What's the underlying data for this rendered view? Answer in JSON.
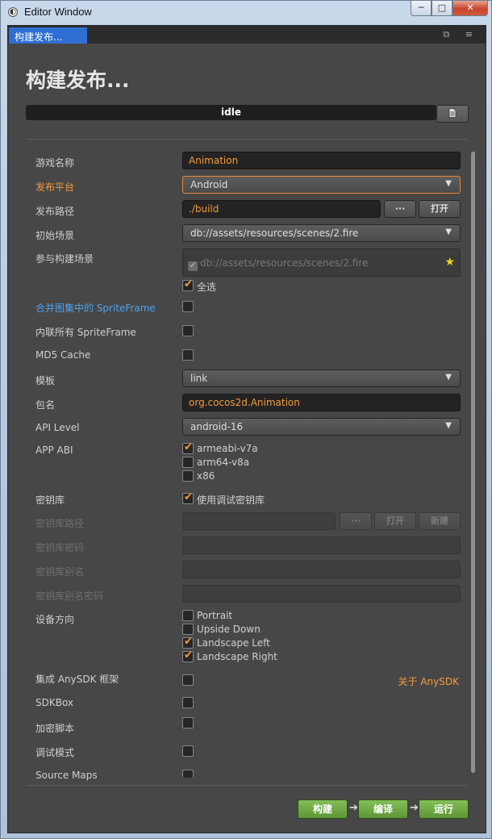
{
  "window": {
    "title": "Editor Window",
    "controls": {
      "minimize": "─",
      "maximize": "□",
      "close": "✕"
    }
  },
  "tab": {
    "label": "构建发布...",
    "tools": "⧉ ≡"
  },
  "heading": "构建发布...",
  "status": {
    "text": "idle",
    "progress": 0,
    "log_icon": "log-file-icon"
  },
  "form": {
    "game_name": {
      "label": "游戏名称",
      "value": "Animation"
    },
    "platform": {
      "label": "发布平台",
      "value": "Android"
    },
    "build_path": {
      "label": "发布路径",
      "value": "./build",
      "browse": "···",
      "open": "打开"
    },
    "start_scene": {
      "label": "初始场景",
      "value": "db://assets/resources/scenes/2.fire"
    },
    "included_scenes": {
      "label": "参与构建场景",
      "item": "db://assets/resources/scenes/2.fire",
      "select_all": "全选"
    },
    "merge_spriteframe": {
      "label": "合并图集中的 SpriteFrame",
      "checked": false
    },
    "inline_spriteframe": {
      "label": "内联所有 SpriteFrame",
      "checked": false
    },
    "md5_cache": {
      "label": "MD5 Cache",
      "checked": false
    },
    "template": {
      "label": "模板",
      "value": "link"
    },
    "package_name": {
      "label": "包名",
      "value": "org.cocos2d.Animation"
    },
    "api_level": {
      "label": "API Level",
      "value": "android-16"
    },
    "app_abi": {
      "label": "APP ABI",
      "options": [
        {
          "label": "armeabi-v7a",
          "checked": true
        },
        {
          "label": "arm64-v8a",
          "checked": false
        },
        {
          "label": "x86",
          "checked": false
        }
      ]
    },
    "keystore": {
      "label": "密钥库",
      "use_debug": "使用调试密钥库",
      "checked": true
    },
    "keystore_path": {
      "label": "密钥库路径",
      "value": "",
      "browse": "···",
      "open": "打开",
      "new": "新建"
    },
    "keystore_password": {
      "label": "密钥库密码",
      "value": ""
    },
    "keystore_alias": {
      "label": "密钥库别名",
      "value": ""
    },
    "keystore_alias_password": {
      "label": "密钥库别名密码",
      "value": ""
    },
    "orientation": {
      "label": "设备方向",
      "options": [
        {
          "label": "Portrait",
          "checked": false
        },
        {
          "label": "Upside Down",
          "checked": false
        },
        {
          "label": "Landscape Left",
          "checked": true
        },
        {
          "label": "Landscape Right",
          "checked": true
        }
      ]
    },
    "anysdk": {
      "label": "集成 AnySDK 框架",
      "checked": false,
      "about": "关于 AnySDK"
    },
    "sdkbox": {
      "label": "SDKBox",
      "checked": false
    },
    "encrypt_js": {
      "label": "加密脚本",
      "checked": false
    },
    "debug_mode": {
      "label": "调试模式",
      "checked": false
    },
    "source_maps": {
      "label": "Source Maps",
      "checked": false
    }
  },
  "actions": {
    "build": "构建",
    "compile": "编译",
    "run": "运行",
    "arrow": "➔"
  },
  "colors": {
    "accent": "#f39c3d",
    "link": "#4aa3f0",
    "tab": "#2f6fd4",
    "action": "#6aa944"
  }
}
